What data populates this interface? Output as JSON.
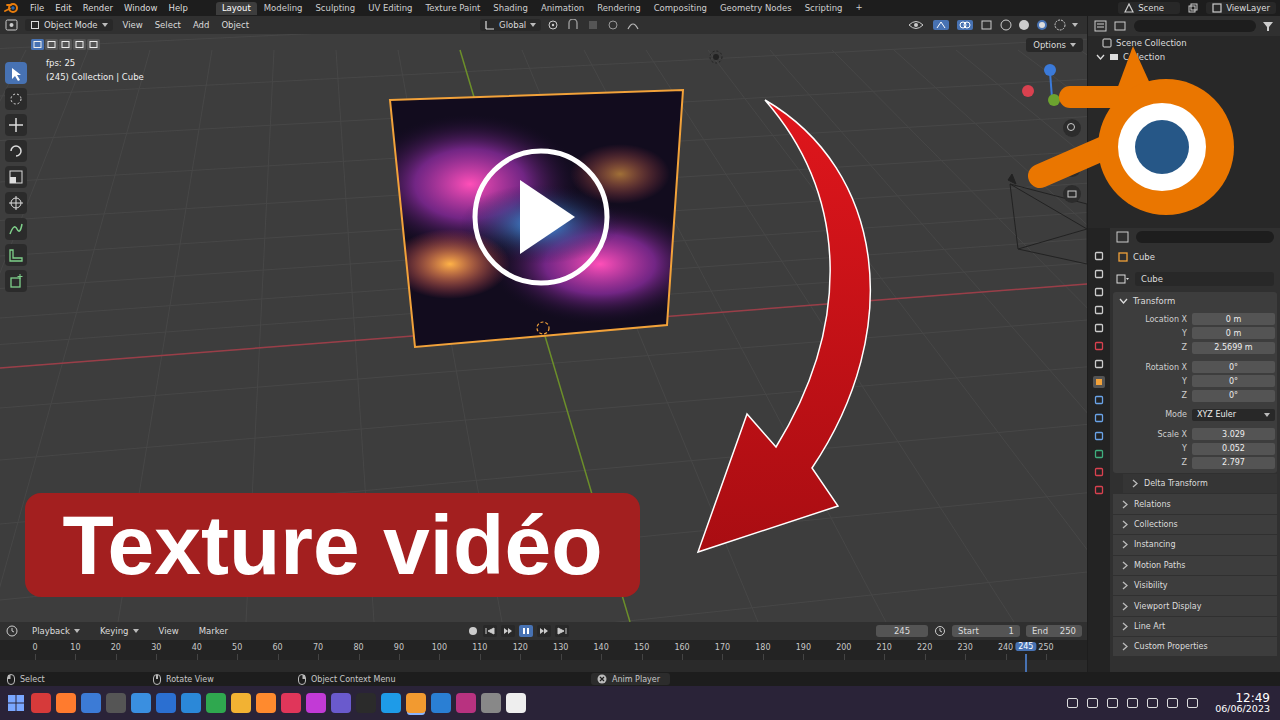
{
  "topbar": {
    "menus": [
      "File",
      "Edit",
      "Render",
      "Window",
      "Help"
    ],
    "workspaces": [
      {
        "label": "Layout",
        "selected": true
      },
      {
        "label": "Modeling",
        "selected": false
      },
      {
        "label": "Sculpting",
        "selected": false
      },
      {
        "label": "UV Editing",
        "selected": false
      },
      {
        "label": "Texture Paint",
        "selected": false
      },
      {
        "label": "Shading",
        "selected": false
      },
      {
        "label": "Animation",
        "selected": false
      },
      {
        "label": "Rendering",
        "selected": false
      },
      {
        "label": "Compositing",
        "selected": false
      },
      {
        "label": "Geometry Nodes",
        "selected": false
      },
      {
        "label": "Scripting",
        "selected": false
      }
    ],
    "add_workspace": "+",
    "scene": "Scene",
    "view_layer": "ViewLayer"
  },
  "viewport": {
    "mode": "Object Mode",
    "menus": [
      "View",
      "Select",
      "Add",
      "Object"
    ],
    "orientation": "Global",
    "options": "Options",
    "info": [
      "fps: 25",
      "(245) Collection | Cube"
    ]
  },
  "thumbnail": {
    "caption": "Texture vidéo"
  },
  "outliner": {
    "root": "Scene Collection",
    "items": [
      {
        "label": "Collection",
        "expanded": true
      }
    ]
  },
  "properties": {
    "object": "Cube",
    "data": "Cube",
    "panel": {
      "label": "Transform",
      "expanded": true
    },
    "groups": [
      [
        {
          "label": "Location X",
          "value": "0 m",
          "kind": "field"
        },
        {
          "label": "Y",
          "value": "0 m",
          "kind": "field"
        },
        {
          "label": "Z",
          "value": "2.5699 m",
          "kind": "field"
        }
      ],
      [
        {
          "label": "Rotation X",
          "value": "0°",
          "kind": "field"
        },
        {
          "label": "Y",
          "value": "0°",
          "kind": "field"
        },
        {
          "label": "Z",
          "value": "0°",
          "kind": "field"
        }
      ],
      [
        {
          "label": "Mode",
          "value": "XYZ Euler",
          "kind": "dropdown"
        }
      ],
      [
        {
          "label": "Scale X",
          "value": "3.029",
          "kind": "field"
        },
        {
          "label": "Y",
          "value": "0.052",
          "kind": "field"
        },
        {
          "label": "Z",
          "value": "2.797",
          "kind": "field"
        }
      ]
    ],
    "sections": [
      {
        "label": "Delta Transform",
        "expanded": false
      },
      {
        "label": "Relations",
        "expanded": false
      },
      {
        "label": "Collections",
        "expanded": false
      },
      {
        "label": "Instancing",
        "expanded": false
      },
      {
        "label": "Motion Paths",
        "expanded": false
      },
      {
        "label": "Visibility",
        "expanded": false
      },
      {
        "label": "Viewport Display",
        "expanded": false
      },
      {
        "label": "Line Art",
        "expanded": false
      },
      {
        "label": "Custom Properties",
        "expanded": false
      }
    ]
  },
  "timeline": {
    "menus": [
      "Playback",
      "Keying",
      "View",
      "Marker"
    ],
    "playing": true,
    "current_frame": "245",
    "start_label": "Start",
    "start": "1",
    "end_label": "End",
    "end": "250",
    "ticks": [
      "0",
      "10",
      "20",
      "30",
      "40",
      "50",
      "60",
      "70",
      "80",
      "90",
      "100",
      "110",
      "120",
      "130",
      "140",
      "150",
      "160",
      "170",
      "180",
      "190",
      "200",
      "210",
      "220",
      "230",
      "240",
      "250"
    ],
    "playhead": "245"
  },
  "status_bar": {
    "items": [
      "Select",
      "Rotate View",
      "Object Context Menu",
      "Anim Player"
    ]
  },
  "taskbar": {
    "time": "12:49",
    "date": "06/06/2023"
  }
}
